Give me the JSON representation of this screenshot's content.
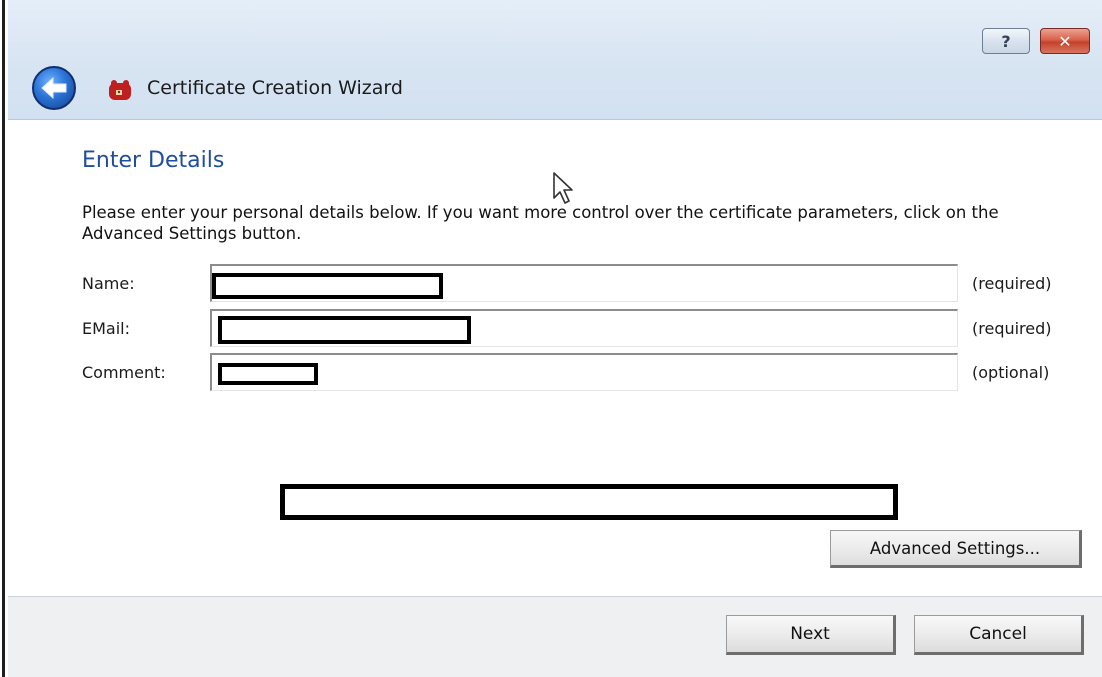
{
  "window": {
    "title": "Certificate Creation Wizard",
    "help_glyph": "?",
    "close_glyph": "✕",
    "accent": "#1f4e9c"
  },
  "page": {
    "heading": "Enter Details",
    "intro": "Please enter your personal details below. If you want more control over the certificate parameters, click on the Advanced Settings button."
  },
  "form": {
    "fields": [
      {
        "label": "Name:",
        "note": "(required)"
      },
      {
        "label": "EMail:",
        "note": "(required)"
      },
      {
        "label": "Comment:",
        "note": "(optional)"
      }
    ]
  },
  "buttons": {
    "advanced": "Advanced Settings...",
    "next": "Next",
    "cancel": "Cancel"
  },
  "icons": {
    "back": "back-arrow-icon",
    "app": "certificate-app-icon",
    "cursor": "mouse-cursor-icon"
  }
}
